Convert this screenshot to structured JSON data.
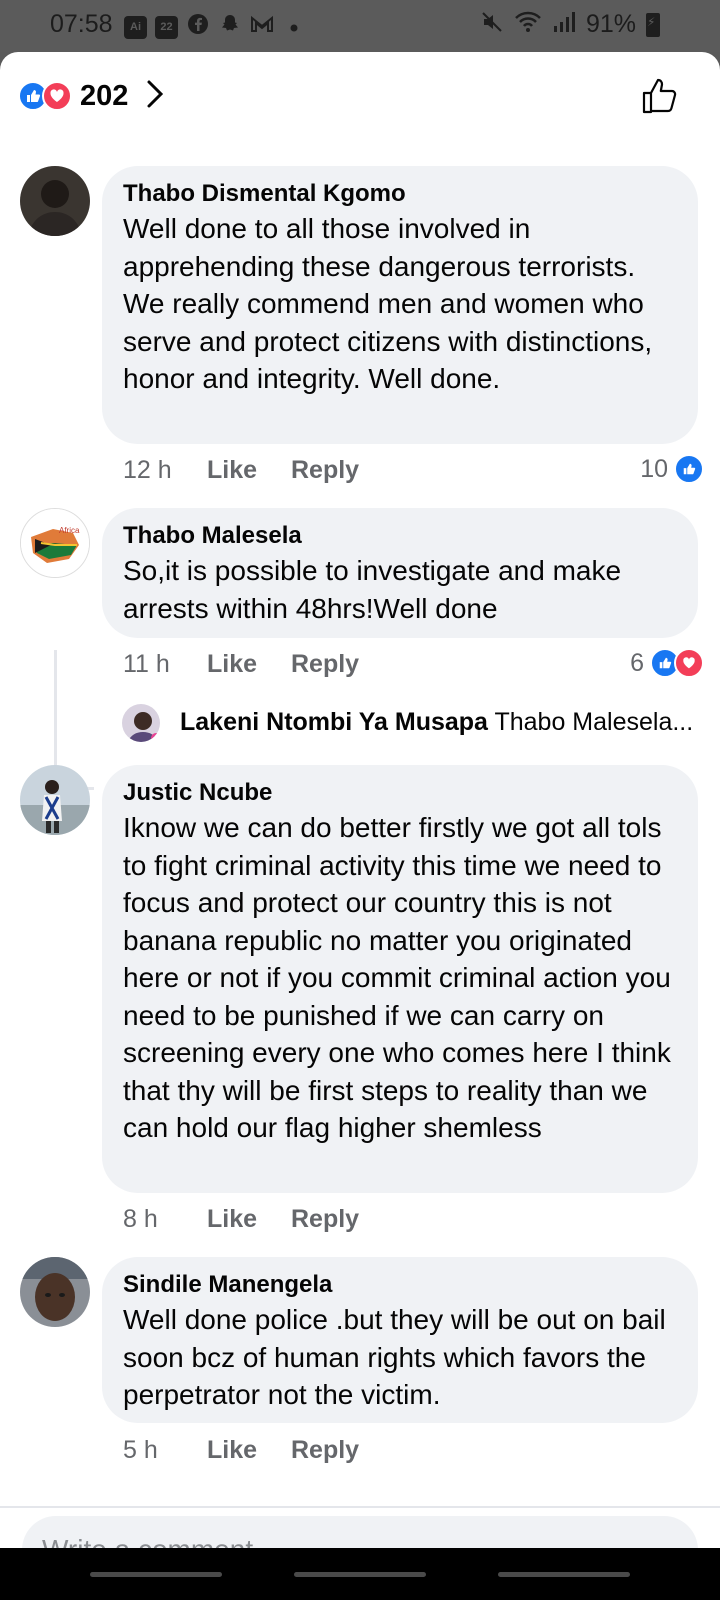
{
  "status_bar": {
    "time": "07:58",
    "left_icons": [
      "ai-app-icon",
      "calendar-22-icon",
      "facebook-icon",
      "snapchat-icon",
      "gmail-icon",
      "dot-icon"
    ],
    "calendar_day": "22",
    "ai_label": "Ai",
    "battery": "91%",
    "right_icons": [
      "mute-icon",
      "wifi-icon",
      "signal-icon",
      "battery-charging-icon"
    ]
  },
  "reactions_header": {
    "count": "202",
    "reaction_types": [
      "like",
      "love"
    ]
  },
  "comments": [
    {
      "author": "Thabo Dismental Kgomo",
      "text": "Well done to all those involved in apprehending these dangerous terrorists. We really commend men and women who serve and protect citizens with distinctions, honor and integrity. Well done.",
      "time": "12 h",
      "like_label": "Like",
      "reply_label": "Reply",
      "reaction_count": "10",
      "reaction_types": [
        "like"
      ]
    },
    {
      "author": "Thabo Malesela",
      "text": "So,it is possible to investigate and make arrests within 48hrs!Well done",
      "time": "11 h",
      "like_label": "Like",
      "reply_label": "Reply",
      "reaction_count": "6",
      "reaction_types": [
        "like",
        "love"
      ],
      "reply_preview": {
        "author": "Lakeni Ntombi Ya Musapa",
        "text": "Thabo Malesela..."
      }
    },
    {
      "author": "Justic Ncube",
      "text": "Iknow we can do better firstly we got all tols to fight criminal activity this time we need to focus and protect our country this is not banana republic no matter you originated here or not if you commit criminal action you need to be punished if we can carry on screening every one who comes here I think that thy will be first steps to reality than we can hold our flag higher shemless",
      "time": "8 h",
      "like_label": "Like",
      "reply_label": "Reply"
    },
    {
      "author": "Sindile Manengela",
      "text": "Well done police .but they will be out on bail soon bcz of human rights which favors the perpetrator not the victim.",
      "time": "5 h",
      "like_label": "Like",
      "reply_label": "Reply"
    }
  ],
  "composer": {
    "placeholder": "Write a comment..."
  },
  "colors": {
    "like_blue": "#1877f2",
    "love_red": "#f33e58",
    "bubble_bg": "#f0f2f5",
    "meta_gray": "#65676b"
  }
}
